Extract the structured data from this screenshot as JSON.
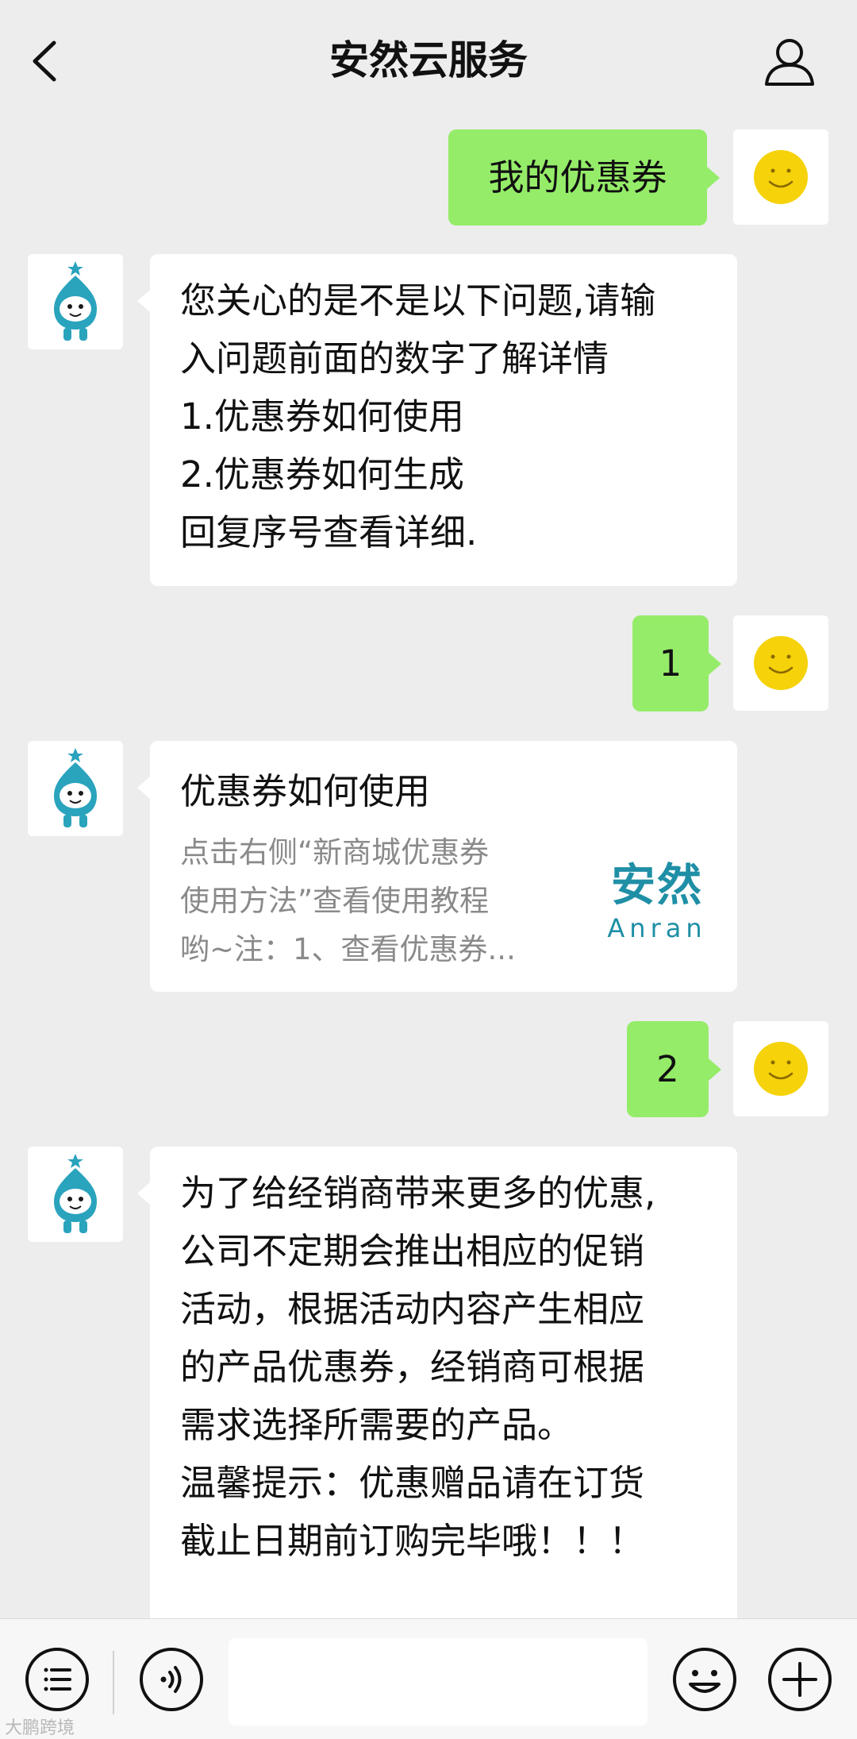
{
  "header": {
    "title": "安然云服务"
  },
  "messages": {
    "m1": {
      "text": "我的优惠券"
    },
    "m2": {
      "lines": [
        "您关心的是不是以下问题,请输",
        "入问题前面的数字了解详情",
        "1.优惠券如何使用",
        "2.优惠券如何生成",
        "回复序号查看详细."
      ]
    },
    "m3": {
      "text": "1"
    },
    "m4": {
      "card_title": "优惠券如何使用",
      "card_desc": [
        "点击右侧“新商城优惠券",
        "使用方法”查看使用教程",
        "哟~注：1、查看优惠券..."
      ],
      "logo_cn": "安然",
      "logo_en": "Anran"
    },
    "m5": {
      "text": "2"
    },
    "m6": {
      "lines": [
        "为了给经销商带来更多的优惠,",
        "公司不定期会推出相应的促销",
        "活动，根据活动内容产生相应",
        "的产品优惠券，经销商可根据",
        "需求选择所需要的产品。",
        "温馨提示：优惠赠品请在订货",
        "截止日期前订购完毕哦！！！"
      ]
    }
  },
  "bottom_bar": {
    "input_value": ""
  },
  "watermark": "大鹏跨境",
  "colors": {
    "sent_bubble": "#95ec69",
    "received_bubble": "#ffffff",
    "background": "#ededed",
    "smiley": "#f5d20a",
    "brand": "#1f8fa6"
  }
}
